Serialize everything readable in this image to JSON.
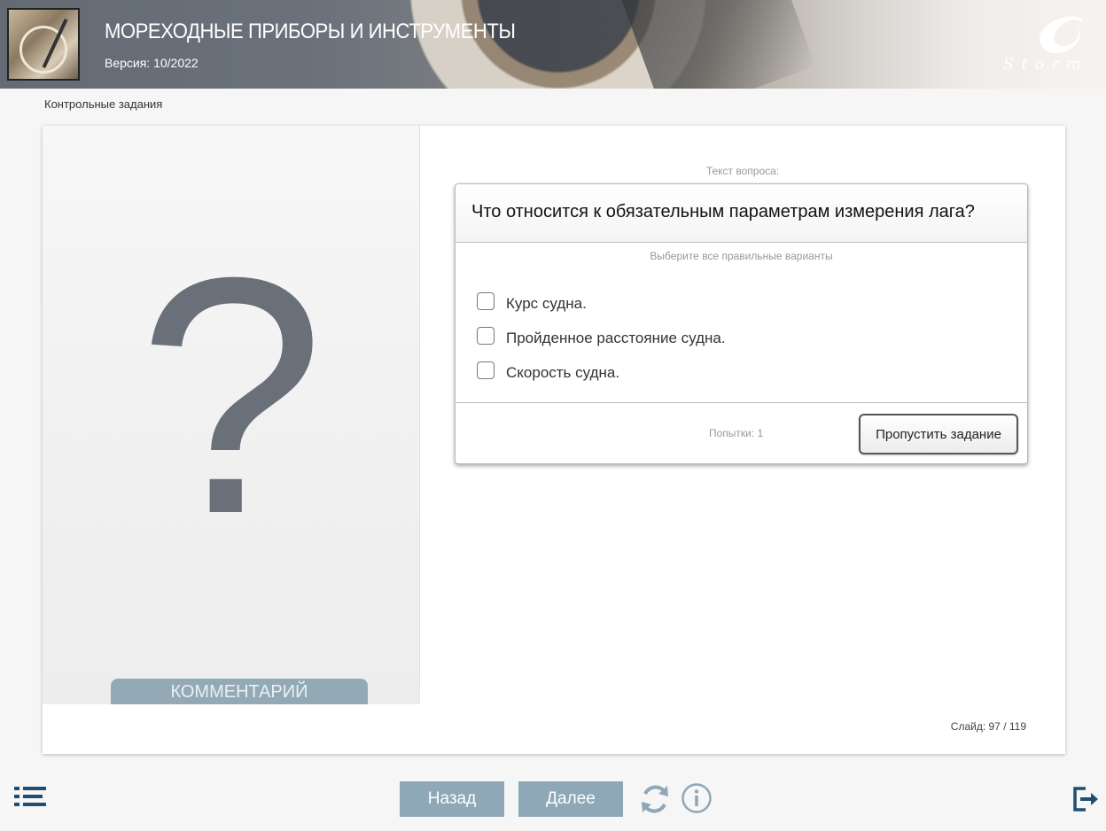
{
  "header": {
    "title": "МОРЕХОДНЫЕ ПРИБОРЫ И ИНСТРУМЕНТЫ",
    "version": "Версия: 10/2022",
    "logo_text": "Storm"
  },
  "breadcrumb": "Контрольные задания",
  "left_panel": {
    "placeholder_glyph": "?",
    "comment_tab": "КОММЕНТАРИЙ"
  },
  "question": {
    "label": "Текст вопроса:",
    "text": "Что относится к обязательным параметрам измерения лага?",
    "hint": "Выберите все правильные варианты",
    "options": [
      {
        "label": "Курс судна.",
        "checked": false
      },
      {
        "label": "Пройденное расстояние судна.",
        "checked": false
      },
      {
        "label": "Скорость судна.",
        "checked": false
      }
    ],
    "attempts": "Попытки: 1",
    "skip_label": "Пропустить задание"
  },
  "slide": "Слайд:  97 / 119",
  "nav": {
    "back_label": "Назад",
    "next_label": "Далее"
  },
  "colors": {
    "accent": "#8fa8b8",
    "icon": "#1f4e72",
    "comment_tab": "#93aab6"
  },
  "icons": [
    "menu-list-icon",
    "reload-icon",
    "info-icon",
    "exit-icon"
  ]
}
